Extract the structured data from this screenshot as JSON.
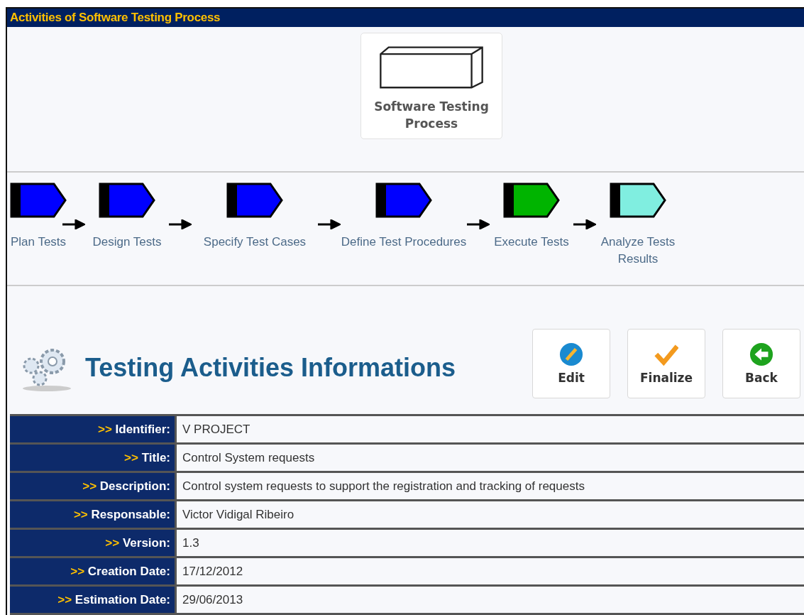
{
  "header": {
    "title": "Activities of Software Testing Process"
  },
  "process": {
    "label": "Software Testing Process"
  },
  "activities": [
    {
      "label": "Plan Tests",
      "color": "#0000ff"
    },
    {
      "label": "Design Tests",
      "color": "#0000ff"
    },
    {
      "label": "Specify Test Cases",
      "color": "#0000ff"
    },
    {
      "label": "Define Test Procedures",
      "color": "#0000ff"
    },
    {
      "label": "Execute Tests",
      "color": "#00b400"
    },
    {
      "label": "Analyze Tests Results",
      "color": "#80eee0"
    }
  ],
  "heading": {
    "title": "Testing Activities Informations"
  },
  "buttons": [
    {
      "kind": "edit",
      "label": "Edit"
    },
    {
      "kind": "finalize",
      "label": "Finalize"
    },
    {
      "kind": "back",
      "label": "Back"
    }
  ],
  "fields": [
    {
      "prefix": ">>",
      "label": "Identifier:",
      "value": "V PROJECT"
    },
    {
      "prefix": ">>",
      "label": "Title:",
      "value": "Control System requests"
    },
    {
      "prefix": ">>",
      "label": "Description:",
      "value": "Control system requests to support the registration and tracking of requests"
    },
    {
      "prefix": ">>",
      "label": "Responsable:",
      "value": "Victor Vidigal Ribeiro"
    },
    {
      "prefix": ">>",
      "label": "Version:",
      "value": "1.3"
    },
    {
      "prefix": ">>",
      "label": "Creation Date:",
      "value": "17/12/2012"
    },
    {
      "prefix": ">>",
      "label": "Estimation Date:",
      "value": "29/06/2013"
    }
  ]
}
